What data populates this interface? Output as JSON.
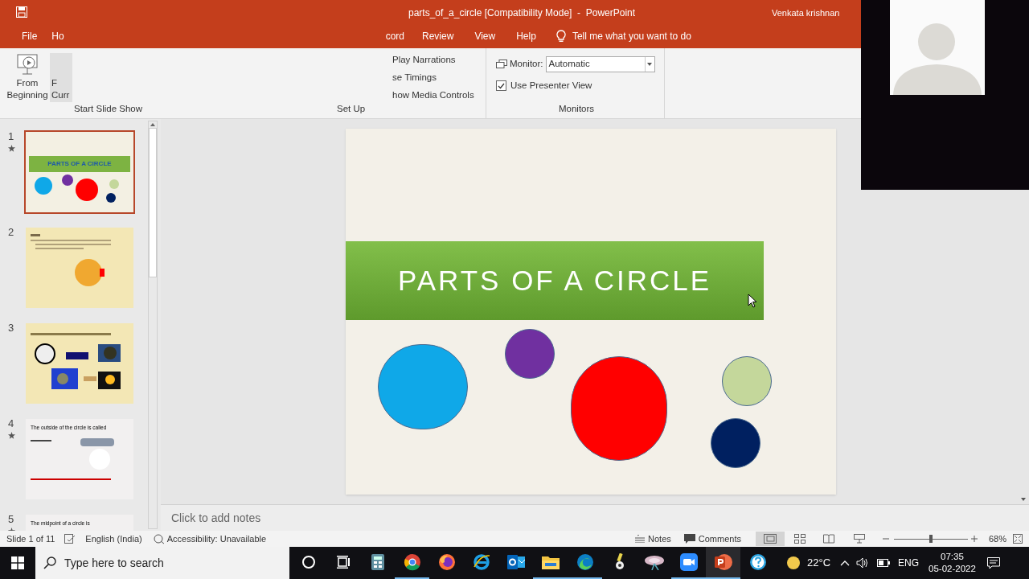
{
  "window": {
    "title": "parts_of_a_circle [Compatibility Mode]  -  PowerPoint",
    "user": "Venkata krishnan"
  },
  "tabs": [
    {
      "label": "File",
      "selected": false
    },
    {
      "label": "Ho",
      "selected": false
    },
    {
      "label": "cord",
      "selected": false
    },
    {
      "label": "Review",
      "selected": false
    },
    {
      "label": "View",
      "selected": false
    },
    {
      "label": "Help",
      "selected": false
    }
  ],
  "tell_me": "Tell me what you want to do",
  "ribbon": {
    "start_group": {
      "label": "Start Slide Show",
      "buttons": [
        {
          "lines": [
            "From",
            "Beginning"
          ],
          "kind": "play"
        },
        {
          "lines": [
            "F",
            "Curr"
          ],
          "kind": "partial"
        }
      ]
    },
    "setup_group": {
      "label": "Set Up",
      "items": [
        "Play Narrations",
        "se Timings",
        "how Media Controls"
      ]
    },
    "monitors_group": {
      "label": "Monitors",
      "monitor_label": "Monitor:",
      "monitor_value": "Automatic",
      "presenter_view": {
        "label": "Use Presenter View",
        "checked": true
      }
    }
  },
  "thumbnails": [
    {
      "number": "1",
      "selected": true,
      "starred": true,
      "kind": "title",
      "text": "PARTS OF A CIRCLE"
    },
    {
      "number": "2",
      "selected": false,
      "starred": false,
      "kind": "circle"
    },
    {
      "number": "3",
      "selected": false,
      "starred": false,
      "kind": "examples"
    },
    {
      "number": "4",
      "selected": false,
      "starred": true,
      "kind": "text",
      "text": "The outside of the circle is called"
    },
    {
      "number": "5",
      "selected": false,
      "starred": true,
      "kind": "text",
      "text": "The midpoint of a circle is"
    }
  ],
  "slide": {
    "title": "PARTS OF A CIRCLE",
    "circles": [
      {
        "color": "#0fa8e8"
      },
      {
        "color": "#7030a0"
      },
      {
        "color": "#ff0000"
      },
      {
        "color": "#c4d79b"
      },
      {
        "color": "#002060"
      }
    ]
  },
  "notes_placeholder": "Click to add notes",
  "status_bar": {
    "slide": "Slide 1 of 11",
    "language": "English (India)",
    "accessibility": "Accessibility: Unavailable",
    "notes": "Notes",
    "comments": "Comments",
    "zoom": "68%",
    "level": 0.5
  },
  "taskbar": {
    "search_placeholder": "Type here to search",
    "apps": [
      {
        "kind": "cortana",
        "running": false
      },
      {
        "kind": "taskview",
        "running": false
      },
      {
        "kind": "calculator",
        "running": false
      },
      {
        "kind": "chrome",
        "running": true
      },
      {
        "kind": "firefox",
        "running": false
      },
      {
        "kind": "ie",
        "running": false
      },
      {
        "kind": "outlook",
        "running": false
      },
      {
        "kind": "explorer",
        "running": true
      },
      {
        "kind": "edge",
        "running": true
      },
      {
        "kind": "tool",
        "running": false
      },
      {
        "kind": "network",
        "running": false
      },
      {
        "kind": "zoom",
        "running": true
      },
      {
        "kind": "powerpoint",
        "running": true
      },
      {
        "kind": "help",
        "running": false
      }
    ],
    "temperature": "22°C",
    "language": "ENG",
    "time": "07:35",
    "date": "05-02-2022"
  }
}
